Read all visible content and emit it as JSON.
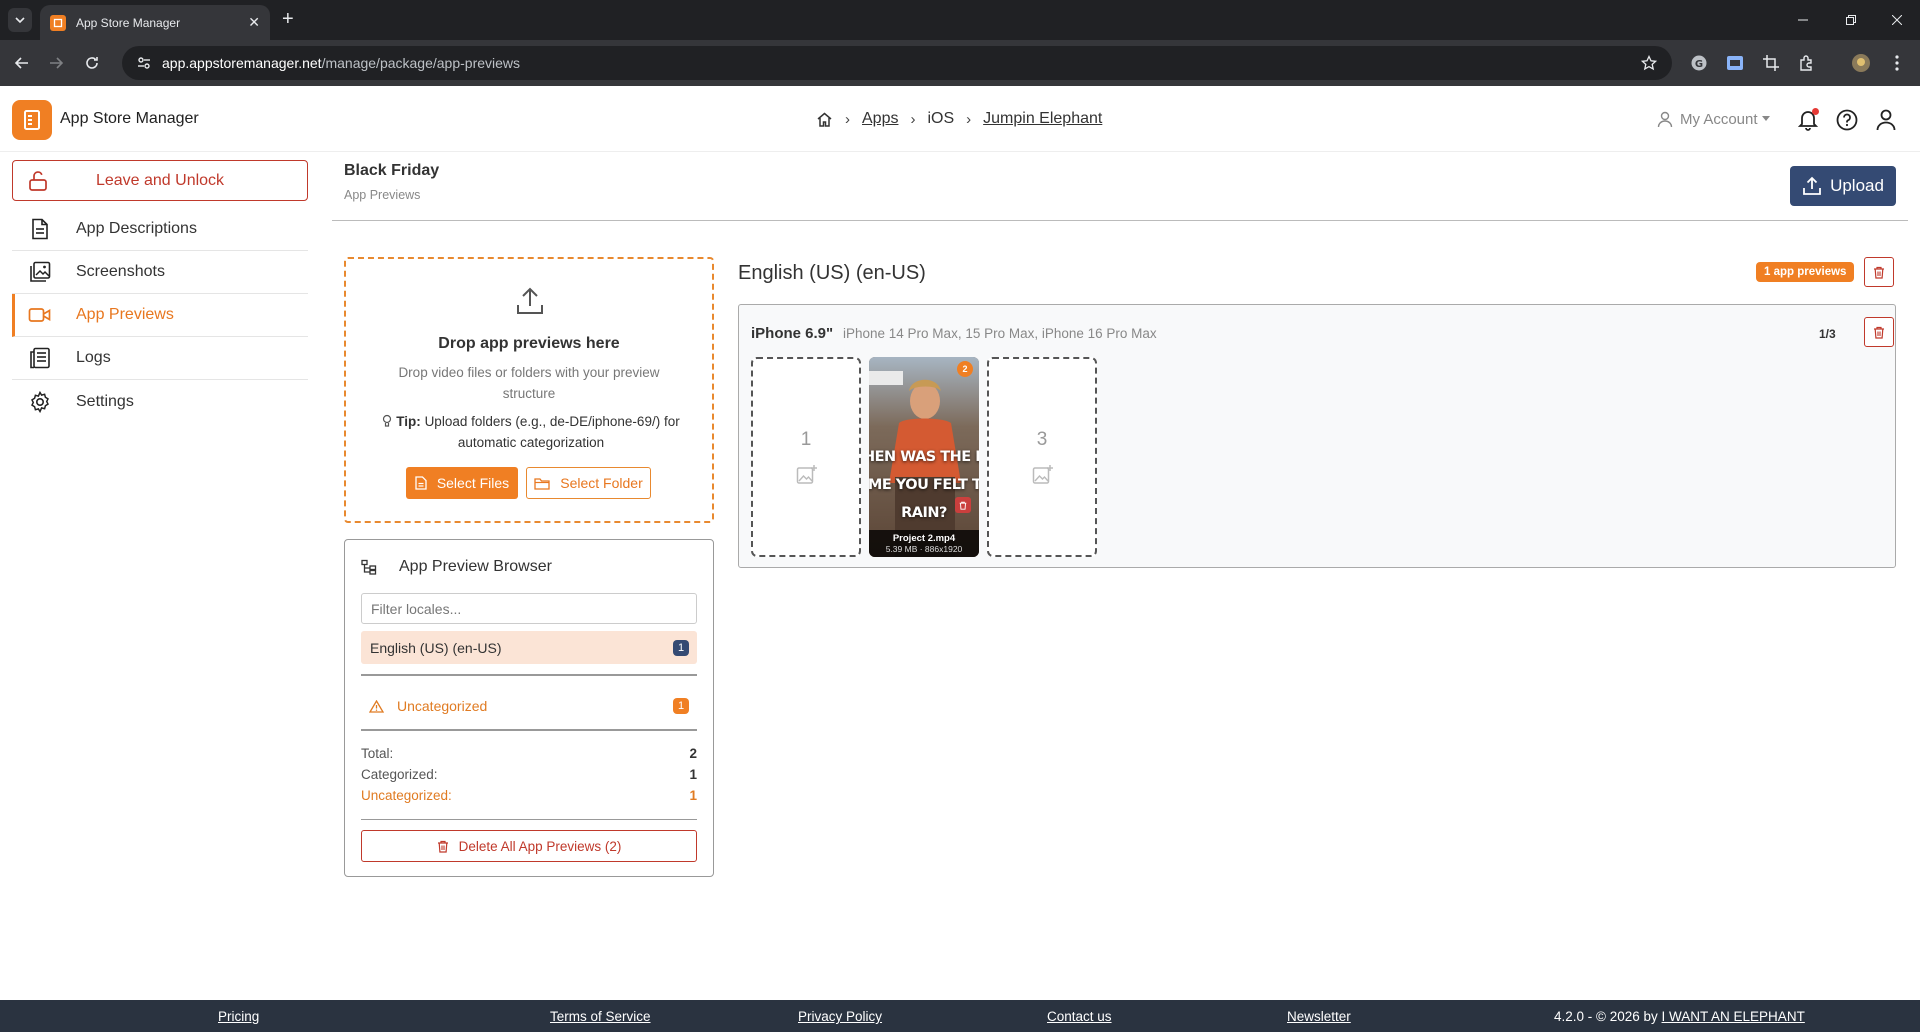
{
  "browser": {
    "tab_title": "App Store Manager",
    "url_host": "app.appstoremanager.net",
    "url_path": "/manage/package/app-previews"
  },
  "header": {
    "brand": "App Store Manager",
    "breadcrumb": [
      "Apps",
      "iOS",
      "Jumpin Elephant"
    ],
    "account_label": "My Account"
  },
  "sidebar": {
    "leave_label": "Leave and Unlock",
    "items": [
      {
        "label": "App Descriptions",
        "icon": "document-icon"
      },
      {
        "label": "Screenshots",
        "icon": "images-icon"
      },
      {
        "label": "App Previews",
        "icon": "video-icon",
        "active": true
      },
      {
        "label": "Logs",
        "icon": "logs-icon"
      },
      {
        "label": "Settings",
        "icon": "gear-icon"
      }
    ]
  },
  "page": {
    "title": "Black Friday",
    "subtitle": "App Previews",
    "upload_label": "Upload"
  },
  "dropzone": {
    "title": "Drop app previews here",
    "description": "Drop video files or folders with your preview structure",
    "tip_label": "Tip:",
    "tip_text": "Upload folders (e.g., de-DE/iphone-69/) for automatic categorization",
    "select_files": "Select Files",
    "select_folder": "Select Folder"
  },
  "preview_browser": {
    "title": "App Preview Browser",
    "filter_placeholder": "Filter locales...",
    "locale": {
      "label": "English (US) (en-US)",
      "count": "1"
    },
    "uncategorized": {
      "label": "Uncategorized",
      "count": "1"
    },
    "stats": {
      "total_label": "Total:",
      "total": "2",
      "categorized_label": "Categorized:",
      "categorized": "1",
      "uncategorized_label": "Uncategorized:",
      "uncategorized": "1"
    },
    "delete_all": "Delete All App Previews (2)"
  },
  "locale_panel": {
    "title": "English (US) (en-US)",
    "count_badge": "1 app previews",
    "device": {
      "name": "iPhone 6.9\"",
      "models": "iPhone 14 Pro Max, 15 Pro Max, iPhone 16 Pro Max",
      "slot_count": "1/3",
      "slots": [
        {
          "number": "1",
          "empty": true
        },
        {
          "number": "2",
          "empty": false,
          "caption": [
            "HEN WAS THE LAS",
            "IME YOU FELT TH",
            "RAIN?"
          ],
          "file": "Project 2.mp4",
          "meta": "5.39 MB · 886x1920"
        },
        {
          "number": "3",
          "empty": true
        }
      ]
    }
  },
  "footer": {
    "links": [
      "Pricing",
      "Terms of Service",
      "Privacy Policy",
      "Contact us",
      "Newsletter"
    ],
    "version": "4.2.0 - © 2026 by",
    "company": "I WANT AN ELEPHANT"
  },
  "colors": {
    "accent": "#f07f23",
    "primary": "#344a73",
    "danger": "#c0392b",
    "footer_bg": "#2a3340"
  }
}
